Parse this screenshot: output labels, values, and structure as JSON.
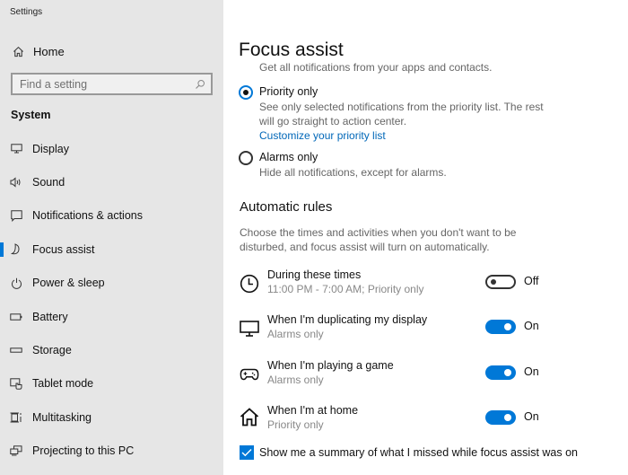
{
  "window": {
    "title": "Settings"
  },
  "sidebar": {
    "home": {
      "label": "Home",
      "icon": "home-icon"
    },
    "search": {
      "placeholder": "Find a setting",
      "value": "",
      "icon": "search-icon"
    },
    "section_header": "System",
    "items": [
      {
        "label": "Display",
        "icon": "display-icon",
        "active": false
      },
      {
        "label": "Sound",
        "icon": "sound-icon",
        "active": false
      },
      {
        "label": "Notifications & actions",
        "icon": "notifications-icon",
        "active": false
      },
      {
        "label": "Focus assist",
        "icon": "moon-icon",
        "active": true
      },
      {
        "label": "Power & sleep",
        "icon": "power-icon",
        "active": false
      },
      {
        "label": "Battery",
        "icon": "battery-icon",
        "active": false
      },
      {
        "label": "Storage",
        "icon": "storage-icon",
        "active": false
      },
      {
        "label": "Tablet mode",
        "icon": "tablet-mode-icon",
        "active": false
      },
      {
        "label": "Multitasking",
        "icon": "multitasking-icon",
        "active": false
      },
      {
        "label": "Projecting to this PC",
        "icon": "projecting-icon",
        "active": false
      }
    ]
  },
  "main": {
    "title": "Focus assist",
    "clipped_text": "Get all notifications from your apps and contacts.",
    "options": [
      {
        "label": "Priority only",
        "description": "See only selected notifications from the priority list. The rest will go straight to action center.",
        "link": "Customize your priority list",
        "selected": true
      },
      {
        "label": "Alarms only",
        "description": "Hide all notifications, except for alarms.",
        "selected": false
      }
    ],
    "automatic_rules": {
      "header": "Automatic rules",
      "description": "Choose the times and activities when you don't want to be disturbed, and focus assist will turn on automatically.",
      "rules": [
        {
          "title": "During these times",
          "subtitle": "11:00 PM - 7:00 AM; Priority only",
          "icon": "clock-icon",
          "on": false,
          "state_label": "Off"
        },
        {
          "title": "When I'm duplicating my display",
          "subtitle": "Alarms only",
          "icon": "monitor-icon",
          "on": true,
          "state_label": "On"
        },
        {
          "title": "When I'm playing a game",
          "subtitle": "Alarms only",
          "icon": "gamepad-icon",
          "on": true,
          "state_label": "On"
        },
        {
          "title": "When I'm at home",
          "subtitle": "Priority only",
          "icon": "home-icon",
          "on": true,
          "state_label": "On"
        }
      ]
    },
    "summary_checkbox": {
      "label": "Show me a summary of what I missed while focus assist was on",
      "checked": true
    }
  },
  "colors": {
    "accent": "#0078d7",
    "link": "#0067b8",
    "sidebar_bg": "#e6e6e6"
  }
}
